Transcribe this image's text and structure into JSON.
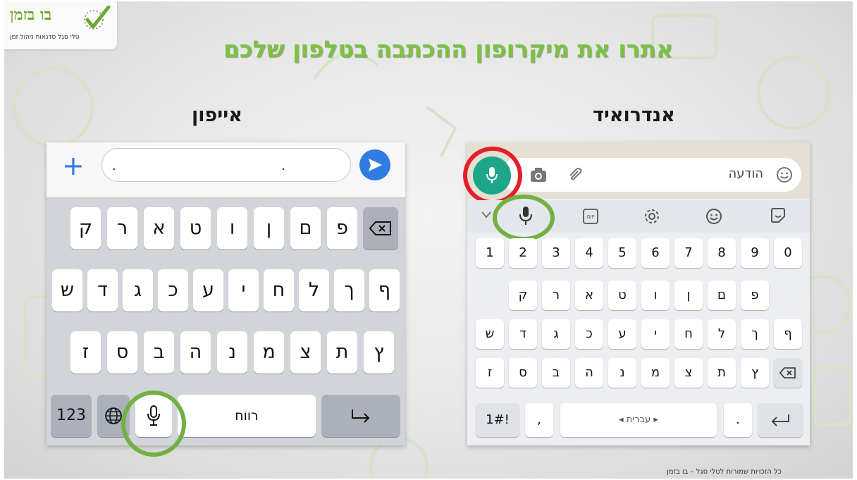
{
  "logo": {
    "name": "בו בזמן",
    "tagline": "טלי סגל סדנאות ניהול זמן"
  },
  "title": "אתרו את מיקרופון ההכתבה בטלפון שלכם",
  "iphone": {
    "heading": "אייפון",
    "field_dots": [
      ".",
      "."
    ],
    "row1": [
      "ק",
      "ר",
      "א",
      "ט",
      "ו",
      "ן",
      "ם",
      "פ"
    ],
    "row2": [
      "ש",
      "ד",
      "ג",
      "כ",
      "ע",
      "י",
      "ח",
      "ל",
      "ך",
      "ף"
    ],
    "row3": [
      "ז",
      "ס",
      "ב",
      "ה",
      "נ",
      "מ",
      "צ",
      "ת",
      "ץ"
    ],
    "numbers_key": "123",
    "space_label": "רווח"
  },
  "android": {
    "heading": "אנדרואיד",
    "message_placeholder": "הודעה",
    "numbers": [
      "1",
      "2",
      "3",
      "4",
      "5",
      "6",
      "7",
      "8",
      "9",
      "0"
    ],
    "row1": [
      "ק",
      "ר",
      "א",
      "ט",
      "ו",
      "ן",
      "ם",
      "פ"
    ],
    "row2": [
      "ש",
      "ד",
      "ג",
      "כ",
      "ע",
      "י",
      "ח",
      "ל",
      "ך",
      "ף"
    ],
    "row3": [
      "ז",
      "ס",
      "ב",
      "ה",
      "נ",
      "מ",
      "צ",
      "ת",
      "ץ"
    ],
    "symbols_key": "1#!",
    "comma_key": ",",
    "space_label": "עברית",
    "period_key": "."
  },
  "footer": "כל הזכויות שמורות לטלי סגל – בו בזמן",
  "colors": {
    "title_green": "#7cc242",
    "ring_green": "#72b043",
    "ring_red": "#e3202a",
    "send_blue": "#2f7de1",
    "whatsapp_green": "#1ea688"
  }
}
